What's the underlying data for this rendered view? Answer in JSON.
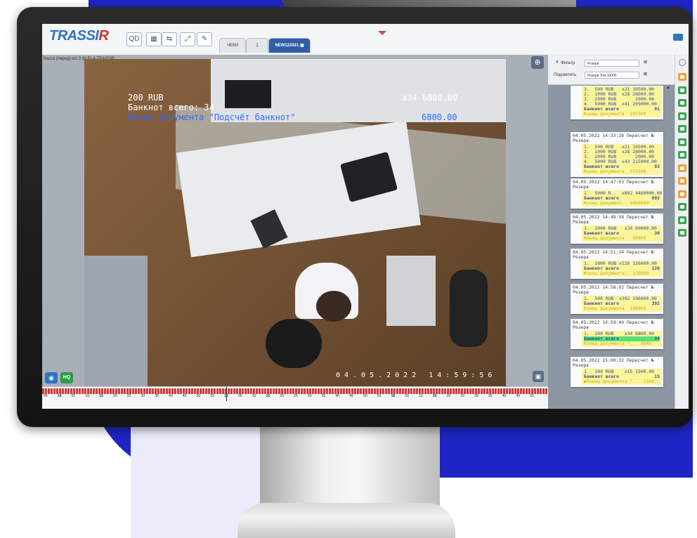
{
  "app": {
    "logo_main": "TRASSI",
    "logo_accent": "R"
  },
  "toolbar": {
    "buttons": [
      "QD",
      "▦",
      "⇆",
      "⤢",
      "✎"
    ],
    "tabs": [
      "ЧЕКИ",
      "1",
      "NEW122021 ▣"
    ]
  },
  "video": {
    "camera_title": "Касса (перед) ext 3 @ BL4-TRASSIR",
    "overlay_denomination": "200 RUB",
    "overlay_count": "Банкнот всего: 34",
    "overlay_end": "Конец документа \"Подсчёт банкнот\"",
    "overlay_right_qty": "x34 6800.00",
    "overlay_right_sum": "6800.00",
    "timestamp": "04.05.2022 14:59:56",
    "zoom_label": "⊕",
    "snapshot_label": "◉",
    "hq_label": "HQ",
    "exit_label": "▣"
  },
  "filters": {
    "filter_label": "Фильтр",
    "filter_value": "Резерв",
    "highlight_label": "Подсветить",
    "highlight_value": "Резерв   Эти 10005"
  },
  "receipts": [
    {
      "header": "",
      "lines": [
        "3.  500 RUB   x21 10500.00",
        "2.  1000 RUB  x28 28000.00",
        "3.  2000 RUB       2000.00",
        "4.  5000 RUB  x41 205000.00"
      ],
      "total_label": "Банкнот всего",
      "total_value": "91",
      "end": "Конец документа  245500"
    },
    {
      "header": "04.05.2022 14:33:28 Пересчет № Резерв",
      "lines": [
        "1.  500 RUB   x21 10500.00",
        "2.  1000 RUB  x28 28000.00",
        "3.  2000 RUB       2000.00",
        "4.  5000 RUB  x43 215000.00"
      ],
      "total_label": "Банкнот всего",
      "total_value": "93",
      "end": "Конец документа  255500"
    },
    {
      "header": "04.05.2022 14:47:03 Пересчет № Резерв",
      "lines": [
        "1.  5000 R..  x892 4460000.00"
      ],
      "total_label": "Банкнот всего",
      "total_value": "892",
      "end": "Конец документ.. 4460000"
    },
    {
      "header": "04.05.2022 14:48:58 Пересчет № Резерв",
      "lines": [
        "1.  2000 RUB   x30 60000.00"
      ],
      "total_label": "Банкнот всего",
      "total_value": "30",
      "end": "Конец документа   60000"
    },
    {
      "header": "04.05.2022 14:51:34 Пересчет № Резерв",
      "lines": [
        "1.  1000 RUB x126 126000.00"
      ],
      "total_label": "Банкнот всего",
      "total_value": "126",
      "end": "Конец документа.. 126000"
    },
    {
      "header": "04.05.2022 14:58:02 Пересчет № Резерв",
      "lines": [
        "1.  500 RUB  x392 196000.00"
      ],
      "total_label": "Банкнот всего",
      "total_value": "392",
      "end": "Конец документа  196000"
    },
    {
      "header": "04.05.2022 14:59:40 Пересчет № Резерв",
      "lines": [
        "1.  200 RUB    x34 6800.00"
      ],
      "total_label": "Банкнот всего",
      "total_value": "34",
      "end": "Конец документа \"..  6800"
    },
    {
      "header": "04.05.2022 15:00:32 Пересчет № Резерв",
      "lines": [
        "1.  100 RUB    x15 1500.00"
      ],
      "total_label": "Банкнот всего",
      "total_value": "15",
      "end": "▶Конец документа \"..  1500"
    }
  ],
  "markers": [
    "orange",
    "green",
    "green",
    "green",
    "green",
    "green",
    "green",
    "orange",
    "orange",
    "orange",
    "green",
    "green",
    "green"
  ],
  "timeline": {
    "ticks": [
      "55",
      "14",
      "05",
      "10",
      "15",
      "20",
      "25",
      "30",
      "35",
      "40",
      "45",
      "50",
      "55",
      "15",
      "05",
      "10",
      "15",
      "20",
      "25",
      "30",
      "35",
      "40",
      "45",
      "50",
      "55",
      "16",
      "05",
      "10",
      "15",
      "20",
      "25",
      "30",
      "35",
      "40",
      "45",
      "50"
    ],
    "bold_ticks": [
      "14",
      "15",
      "16"
    ]
  },
  "colors": {
    "brand_blue": "#2f73c6",
    "logo_red": "#d0312d",
    "receipt_yellow": "#fbf59a",
    "highlight_green": "#57e07a",
    "background_blue": "#1f25c4"
  }
}
